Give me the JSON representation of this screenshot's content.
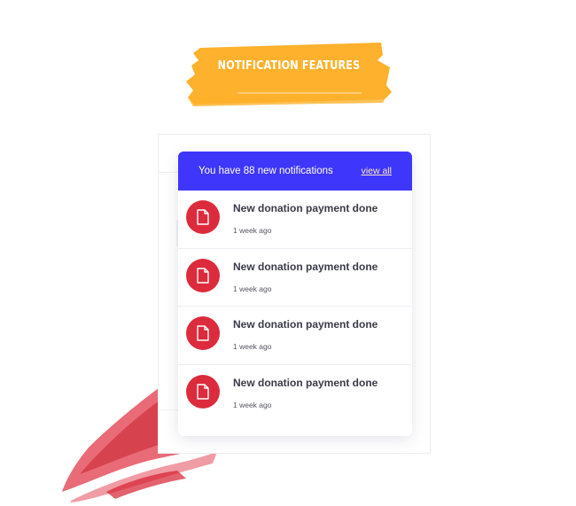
{
  "banner": {
    "title": "NOTIFICATION FEATURES"
  },
  "colors": {
    "banner": "#fdb12c",
    "header": "#3e36fb",
    "icon": "#dc2b3c",
    "accent_red": "#e23a4a"
  },
  "dropdown": {
    "header_text": "You have 88 new notifications",
    "view_all_label": "view all",
    "items": [
      {
        "title": "New donation payment done",
        "time": "1 week ago",
        "icon": "file-icon"
      },
      {
        "title": "New donation payment done",
        "time": "1 week ago",
        "icon": "file-icon"
      },
      {
        "title": "New donation payment done",
        "time": "1 week ago",
        "icon": "file-icon"
      },
      {
        "title": "New donation payment done",
        "time": "1 week ago",
        "icon": "file-icon"
      }
    ]
  }
}
